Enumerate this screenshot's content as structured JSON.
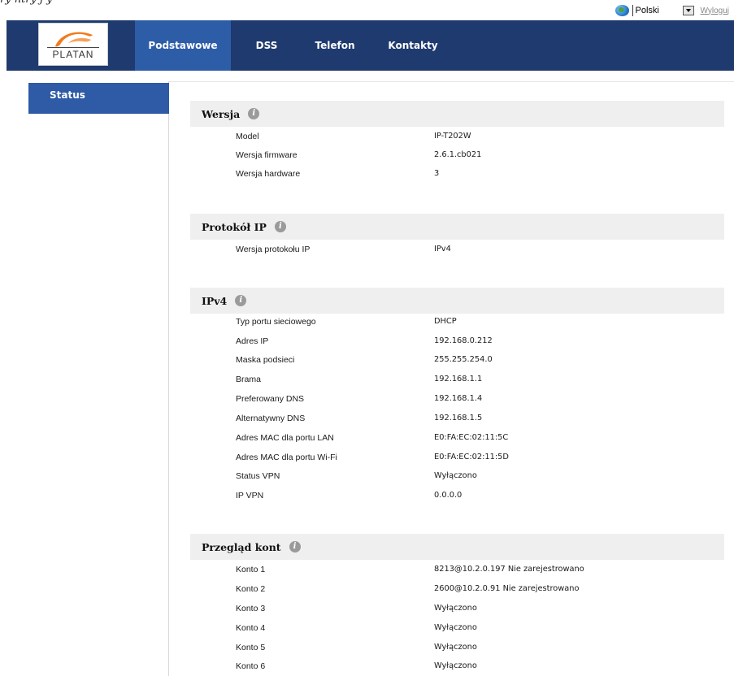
{
  "window": {
    "truncated_title": "ry            ntry          j   y"
  },
  "topbar": {
    "language_value": "Polski",
    "logout_label": "Wyloguj"
  },
  "brand": {
    "logo_text": "PLATAN"
  },
  "nav": {
    "tabs": [
      {
        "label": "Podstawowe",
        "active": true
      },
      {
        "label": "DSS",
        "active": false
      },
      {
        "label": "Telefon",
        "active": false
      },
      {
        "label": "Kontakty",
        "active": false
      }
    ]
  },
  "sidebar": {
    "items": [
      {
        "label": "Status",
        "active": true
      }
    ]
  },
  "sections": [
    {
      "title": "Wersja",
      "rows": [
        {
          "key": "Model",
          "value": "IP-T202W"
        },
        {
          "key": "Wersja firmware",
          "value": "2.6.1.cb021"
        },
        {
          "key": "Wersja hardware",
          "value": "3"
        }
      ]
    },
    {
      "title": "Protokół IP",
      "rows": [
        {
          "key": "Wersja protokołu IP",
          "value": "IPv4"
        }
      ]
    },
    {
      "title": "IPv4",
      "rows": [
        {
          "key": "Typ portu sieciowego",
          "value": "DHCP"
        },
        {
          "key": "Adres IP",
          "value": "192.168.0.212"
        },
        {
          "key": "Maska podsieci",
          "value": "255.255.254.0"
        },
        {
          "key": "Brama",
          "value": "192.168.1.1"
        },
        {
          "key": "Preferowany DNS",
          "value": "192.168.1.4"
        },
        {
          "key": "Alternatywny DNS",
          "value": "192.168.1.5"
        },
        {
          "key": "Adres MAC dla portu LAN",
          "value": "E0:FA:EC:02:11:5C"
        },
        {
          "key": "Adres MAC dla portu Wi-Fi",
          "value": "E0:FA:EC:02:11:5D"
        },
        {
          "key": "Status VPN",
          "value": "Wyłączono"
        },
        {
          "key": "IP VPN",
          "value": "0.0.0.0"
        }
      ]
    },
    {
      "title": "Przegląd kont",
      "rows": [
        {
          "key": "Konto 1",
          "value": "8213@10.2.0.197 Nie zarejestrowano"
        },
        {
          "key": "Konto 2",
          "value": "2600@10.2.0.91 Nie zarejestrowano"
        },
        {
          "key": "Konto 3",
          "value": "Wyłączono"
        },
        {
          "key": "Konto 4",
          "value": "Wyłączono"
        },
        {
          "key": "Konto 5",
          "value": "Wyłączono"
        },
        {
          "key": "Konto 6",
          "value": "Wyłączono"
        }
      ]
    }
  ],
  "colors": {
    "navbar": "#1f3a6e",
    "active_tab": "#2e5da8",
    "sidebar_active": "#2e5aa6",
    "section_header_bg": "#efefef",
    "logo_orange": "#f07c1e"
  }
}
